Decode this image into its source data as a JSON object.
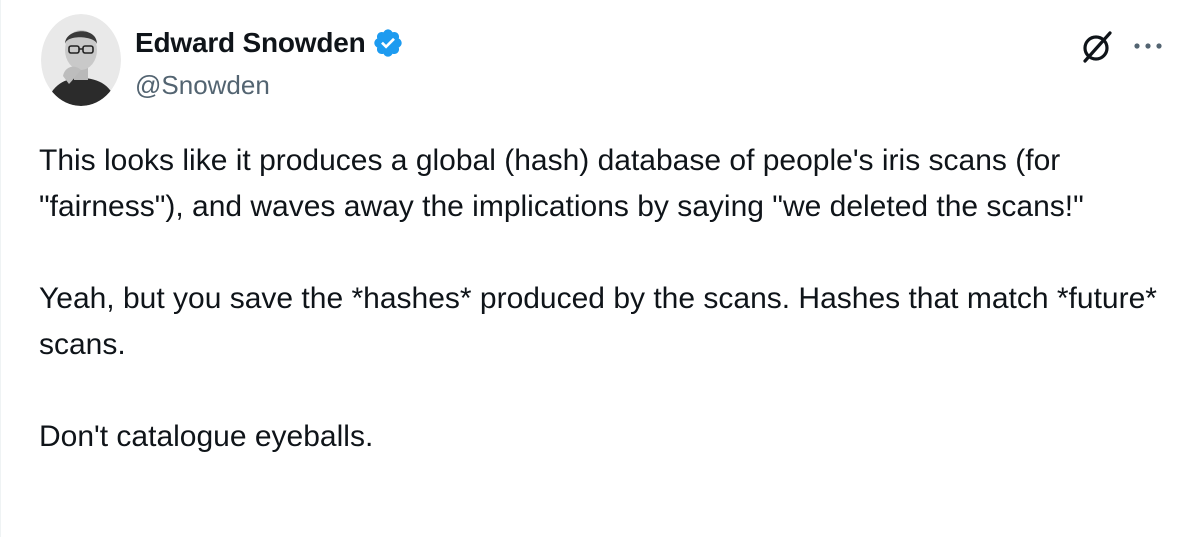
{
  "author": {
    "name": "Edward Snowden",
    "handle": "@Snowden",
    "verified": true
  },
  "icons": {
    "avatar": "user-photo",
    "verified": "verified-badge-icon",
    "grok": "grok-icon",
    "more": "more-options-icon"
  },
  "colors": {
    "verified_blue": "#1d9bf0",
    "handle_gray": "#536471",
    "text": "#0f1419"
  },
  "tweet": {
    "paragraphs": [
      "This looks like it produces a global (hash) database of people's iris scans (for \"fairness\"), and waves away the implications by saying \"we deleted the scans!\"",
      "Yeah, but you save the *hashes* produced by the scans. Hashes that match *future* scans.",
      "Don't catalogue eyeballs."
    ]
  }
}
